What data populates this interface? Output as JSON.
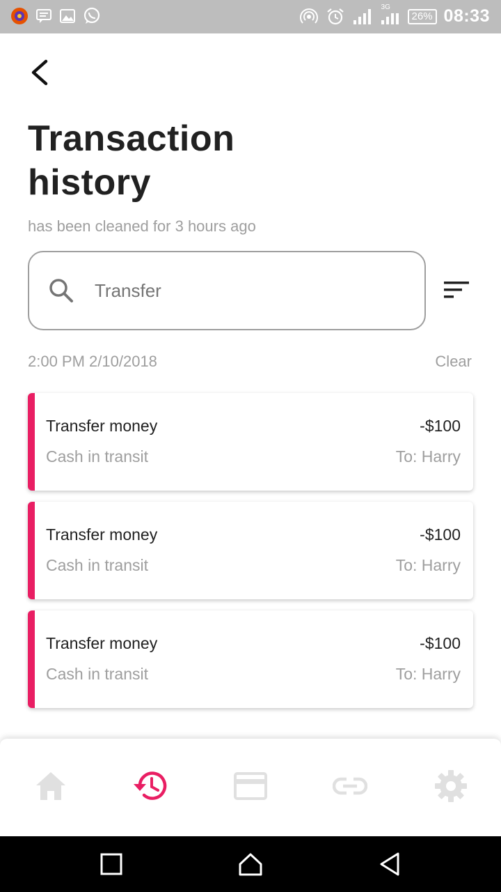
{
  "status_bar": {
    "battery": "26%",
    "time": "08:33",
    "network_label": "3G"
  },
  "header": {
    "title": "Transaction history",
    "subtitle": "has been cleaned for 3 hours ago"
  },
  "search": {
    "value": "Transfer",
    "placeholder": "Search"
  },
  "filter": {
    "date": "2:00 PM 2/10/2018",
    "clear_label": "Clear"
  },
  "transactions": [
    {
      "title": "Transfer money",
      "amount": "-$100",
      "subtitle": "Cash in transit",
      "recipient": "To: Harry"
    },
    {
      "title": "Transfer money",
      "amount": "-$100",
      "subtitle": "Cash in transit",
      "recipient": "To: Harry"
    },
    {
      "title": "Transfer money",
      "amount": "-$100",
      "subtitle": "Cash in transit",
      "recipient": "To: Harry"
    }
  ],
  "bottom_nav": {
    "items": [
      {
        "icon": "home-icon",
        "active": false
      },
      {
        "icon": "history-icon",
        "active": true
      },
      {
        "icon": "card-icon",
        "active": false
      },
      {
        "icon": "link-icon",
        "active": false
      },
      {
        "icon": "gear-icon",
        "active": false
      }
    ]
  },
  "colors": {
    "accent": "#e91e63",
    "status_bar": "#bdbdbd",
    "inactive_icon": "#e0e0e0",
    "title_text": "#212121",
    "muted_text": "#9e9e9e"
  }
}
